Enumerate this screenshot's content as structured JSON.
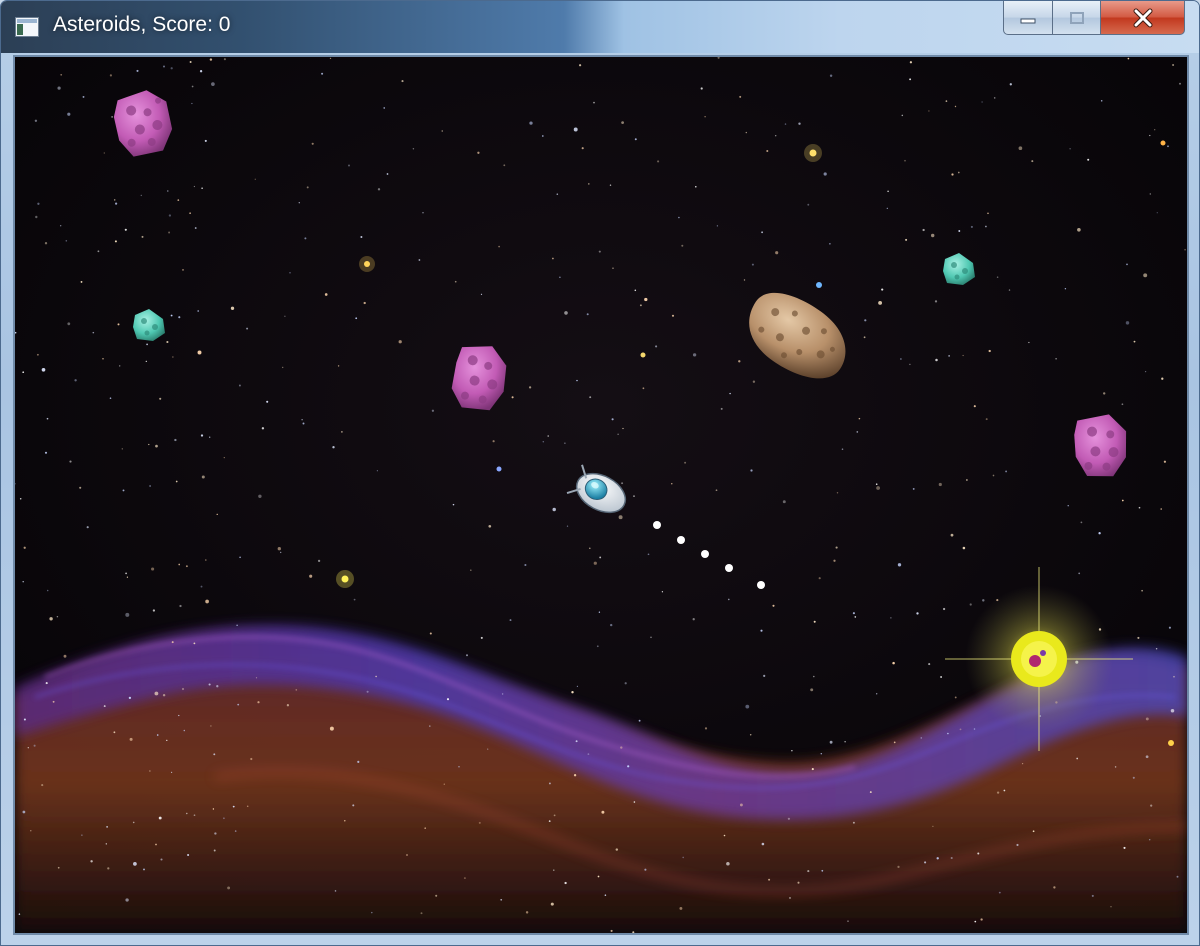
{
  "window": {
    "title": "Asteroids, Score: 0",
    "app_icon": "window-app-icon",
    "buttons": [
      {
        "name": "minimize-button",
        "icon": "minimize-icon"
      },
      {
        "name": "maximize-button",
        "icon": "maximize-icon"
      },
      {
        "name": "close-button",
        "icon": "close-icon"
      }
    ]
  },
  "game": {
    "score": 0,
    "background": "starfield-with-nebula",
    "colors": {
      "space": "#07050a",
      "asteroid_pink": "#c25bb5",
      "asteroid_teal": "#4fc8b2",
      "asteroid_brown": "#b8906a",
      "bullet": "#ffffff",
      "powerup_glow": "#e6e820"
    },
    "entities": [
      "asteroid-pink-large",
      "asteroid-pink-medium",
      "asteroid-pink-right",
      "asteroid-teal-left",
      "asteroid-teal-right",
      "asteroid-brown-large",
      "player-ship",
      "bullet",
      "powerup-orb"
    ],
    "bullet_count": 5
  }
}
